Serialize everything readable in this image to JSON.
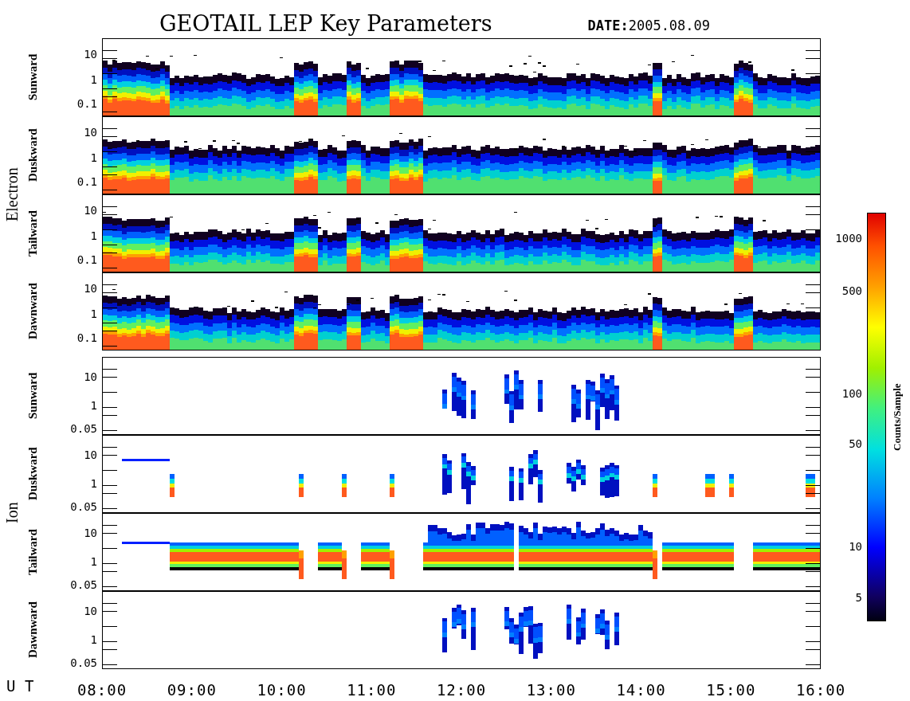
{
  "title": "GEOTAIL LEP Key Parameters",
  "date": "**DATE:**2005.08.09",
  "groups": [
    {
      "label": "Electron",
      "kind": "electron",
      "panels": [
        {
          "label": "Sunward",
          "yticks": [
            "10",
            "1",
            "0.1"
          ]
        },
        {
          "label": "Duskward",
          "yticks": [
            "10",
            "1",
            "0.1"
          ]
        },
        {
          "label": "Tailward",
          "yticks": [
            "10",
            "1",
            "0.1"
          ]
        },
        {
          "label": "Dawnward",
          "yticks": [
            "10",
            "1",
            "0.1"
          ]
        }
      ]
    },
    {
      "label": "Ion",
      "kind": "ion",
      "panels": [
        {
          "label": "Sunward",
          "yticks": [
            "10",
            "1",
            "0.05"
          ]
        },
        {
          "label": "Duskward",
          "yticks": [
            "10",
            "1",
            "0.05"
          ]
        },
        {
          "label": "Tailward",
          "yticks": [
            "10",
            "1",
            "0.05"
          ]
        },
        {
          "label": "Dawnward",
          "yticks": [
            "10",
            "1",
            "0.05"
          ]
        }
      ]
    }
  ],
  "x_axis": {
    "label": "U T",
    "ticks": [
      "08:00",
      "09:00",
      "10:00",
      "11:00",
      "12:00",
      "13:00",
      "14:00",
      "15:00",
      "16:00"
    ]
  },
  "colorbar": {
    "title": "Counts/Sample",
    "ticks": [
      "1000",
      "500",
      "100",
      "50",
      "10",
      "5"
    ]
  }
}
